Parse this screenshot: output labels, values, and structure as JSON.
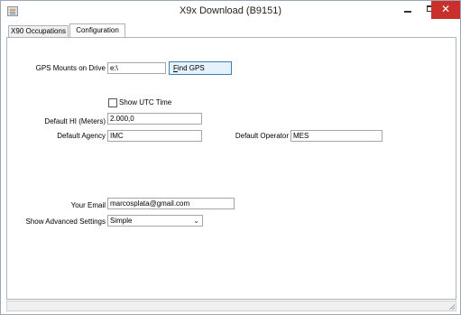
{
  "window": {
    "title": "X9x Download  (B9151)",
    "close_glyph": "✕"
  },
  "tabs": [
    {
      "label": "X90 Occupations",
      "selected": false
    },
    {
      "label": "Configuration",
      "selected": true
    }
  ],
  "config": {
    "gps_mounts_label": "GPS Mounts on Drive",
    "gps_mounts_value": "e:\\",
    "find_gps_label": "Find GPS",
    "show_utc_label": "Show UTC Time",
    "show_utc_checked": false,
    "default_hi_label": "Default HI (Meters)",
    "default_hi_value": "2.000,0",
    "default_agency_label": "Default Agency",
    "default_agency_value": "IMC",
    "default_operator_label": "Default Operator",
    "default_operator_value": "MES",
    "email_label": "Your Email",
    "email_value": "marcosplata@gmail.com",
    "advanced_label": "Show Advanced Settings",
    "advanced_value": "Simple"
  },
  "icons": {
    "app": "app-icon",
    "minimize": "minimize-icon",
    "maximize": "maximize-icon",
    "close": "close-icon",
    "dropdown": "chevron-down-icon"
  },
  "colors": {
    "close_button": "#c9302c",
    "button_border": "#3c7fb1",
    "button_fill": "#e5f1fb"
  }
}
